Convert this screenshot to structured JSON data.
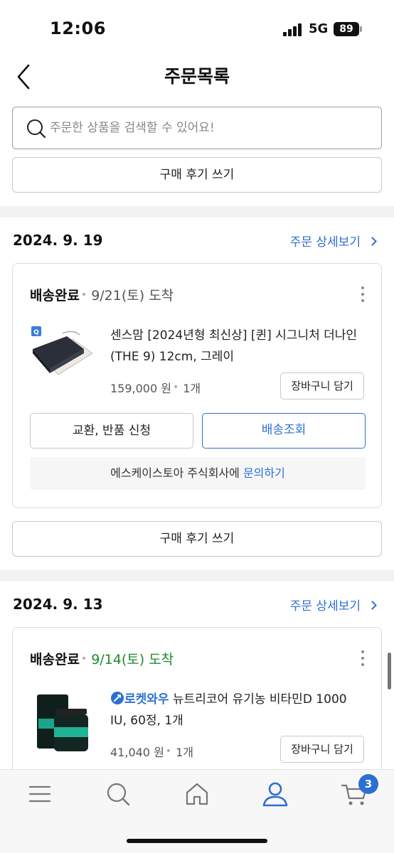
{
  "status_bar": {
    "time": "12:06",
    "network": "5G",
    "battery": "89"
  },
  "header": {
    "title": "주문목록"
  },
  "search": {
    "placeholder": "주문한 상품을 검색할 수 있어요!"
  },
  "review_button": {
    "label": "구매 후기 쓰기"
  },
  "orders": [
    {
      "date": "2024. 9. 19",
      "detail_link": "주문 상세보기",
      "status": "배송완료",
      "arrival": "9/21(토) 도착",
      "arrival_color": "#555555",
      "product_name": "센스맘 [2024년형 최신상] [퀸] 시그니처 더나인 (THE 9) 12cm, 그레이",
      "price": "159,000 원",
      "quantity": "1개",
      "cart_button": "장바구니 담기",
      "exchange_button": "교환, 반품 신청",
      "tracking_button": "배송조회",
      "seller_text": "에스케이스토아 주식회사에 ",
      "inquiry_link": "문의하기",
      "review_button": "구매 후기 쓰기"
    },
    {
      "date": "2024. 9. 13",
      "detail_link": "주문 상세보기",
      "status": "배송완료",
      "arrival": "9/14(토) 도착",
      "arrival_color": "#1f8a2c",
      "badge": "로켓와우",
      "product_name": "뉴트리코어 유기농 비타민D 1000 IU, 60정, 1개",
      "price": "41,040 원",
      "quantity": "1개",
      "cart_button": "장바구니 담기"
    }
  ],
  "bottom_nav": {
    "items": [
      "menu-icon",
      "search-icon",
      "home-icon",
      "user-icon",
      "cart-icon"
    ],
    "active": "user-icon",
    "cart_count": "3"
  },
  "colors": {
    "accent": "#2d6fd1",
    "arrival_green": "#1f8a2c"
  }
}
